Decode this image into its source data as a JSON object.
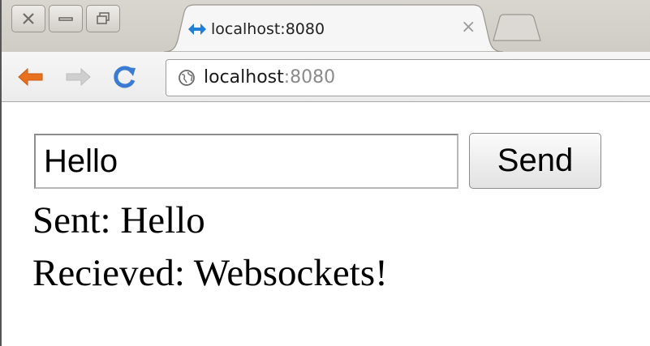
{
  "tab": {
    "title": "localhost:8080",
    "close_glyph": "×",
    "favicon": "websocket-arrows-icon"
  },
  "window_controls": {
    "close": "close-icon",
    "minimize": "minimize-icon",
    "maximize": "restore-icon"
  },
  "toolbar": {
    "back": "back-arrow-icon",
    "forward": "forward-arrow-icon",
    "reload": "reload-icon"
  },
  "omnibox": {
    "host": "localhost",
    "port": ":8080",
    "site_icon": "globe-icon"
  },
  "page": {
    "input_value": "Hello",
    "send_label": "Send",
    "sent_text": "Sent: Hello",
    "received_text": "Recieved: Websockets!"
  },
  "colors": {
    "back_arrow": "#e8711f",
    "reload": "#3b7bd4",
    "favicon": "#1f7ed6"
  }
}
